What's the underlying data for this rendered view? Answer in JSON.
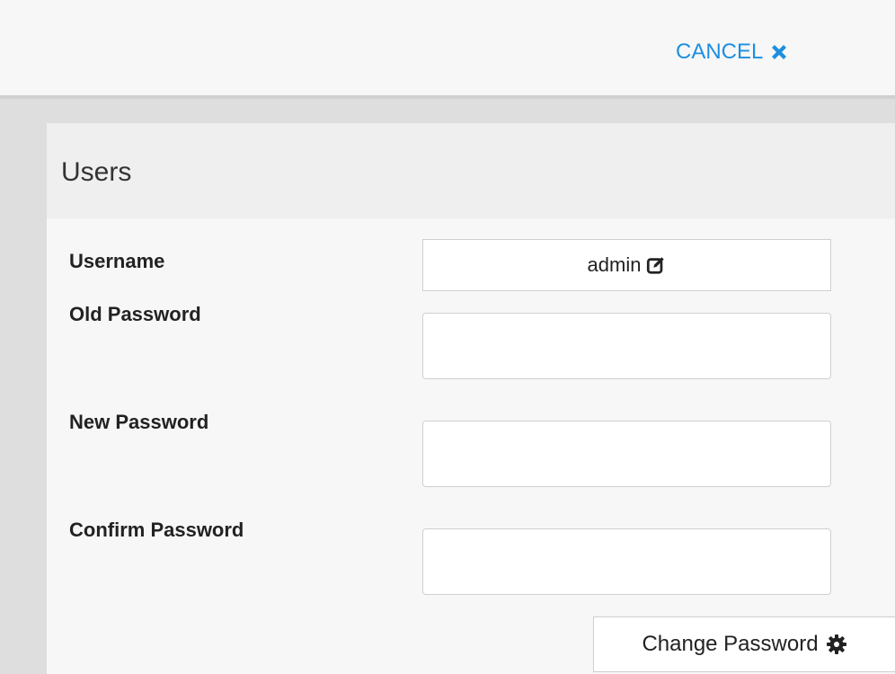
{
  "header": {
    "cancel_label": "CANCEL",
    "cancel_icon": "close-icon",
    "accent_color": "#1e8fe0"
  },
  "panel": {
    "title": "Users"
  },
  "form": {
    "username_label": "Username",
    "username_value": "admin",
    "username_edit_icon": "edit-icon",
    "old_password_label": "Old Password",
    "old_password_value": "",
    "new_password_label": "New Password",
    "new_password_value": "",
    "confirm_password_label": "Confirm Password",
    "confirm_password_value": "",
    "submit_label": "Change Password",
    "submit_icon": "gear-icon"
  }
}
